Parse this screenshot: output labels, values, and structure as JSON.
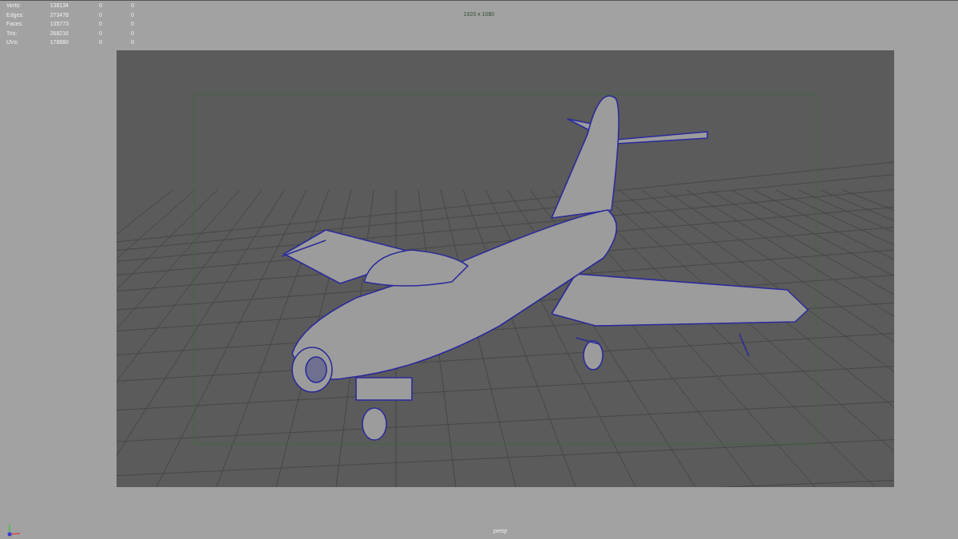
{
  "heads_up_display": {
    "stats": [
      {
        "label": "Verts:",
        "value": "138134",
        "column_3": "0",
        "column_4": "0"
      },
      {
        "label": "Edges:",
        "value": "273478",
        "column_3": "0",
        "column_4": "0"
      },
      {
        "label": "Faces:",
        "value": "135773",
        "column_3": "0",
        "column_4": "0"
      },
      {
        "label": "Tris:",
        "value": "268216",
        "column_3": "0",
        "column_4": "0"
      },
      {
        "label": "UVs:",
        "value": "176860",
        "column_3": "0",
        "column_4": "0"
      }
    ],
    "resolution": "1920 x 1080",
    "camera": "persp"
  }
}
